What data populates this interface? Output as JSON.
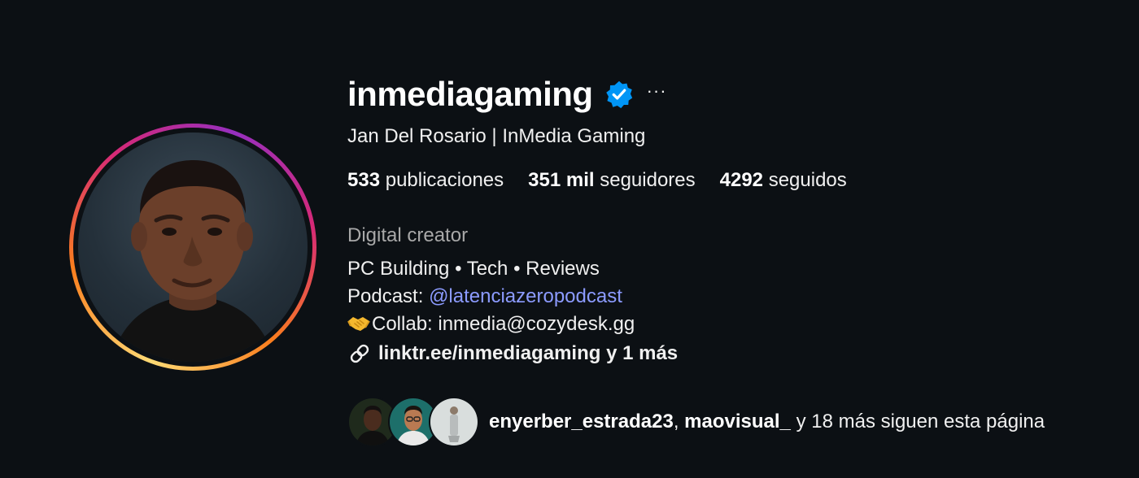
{
  "profile": {
    "username": "inmediagaming",
    "more_label": "···",
    "full_name": "Jan Del Rosario | InMedia Gaming",
    "stats": {
      "posts_count": "533",
      "posts_label": "publicaciones",
      "followers_count": "351 mil",
      "followers_label": "seguidores",
      "following_count": "4292",
      "following_label": "seguidos"
    },
    "category": "Digital creator",
    "bio": {
      "line1": "PC Building • Tech • Reviews",
      "podcast_prefix": "Podcast: ",
      "podcast_mention": "@latenciazeropodcast",
      "collab_text": "Collab: inmedia@cozydesk.gg"
    },
    "link": "linktr.ee/inmediagaming y 1 más"
  },
  "followed_by": {
    "user1": "enyerber_estrada23",
    "separator": ", ",
    "user2": "maovisual_",
    "suffix": " y 18 más siguen esta página"
  },
  "colors": {
    "background": "#0c1014",
    "verified_badge": "#0095f6",
    "mention": "#8c9bff",
    "secondary_text": "#a8a8a8"
  },
  "icons": {
    "verified": "verified-badge-icon",
    "more": "more-options-icon",
    "collab": "handshake-icon",
    "link": "link-icon"
  }
}
